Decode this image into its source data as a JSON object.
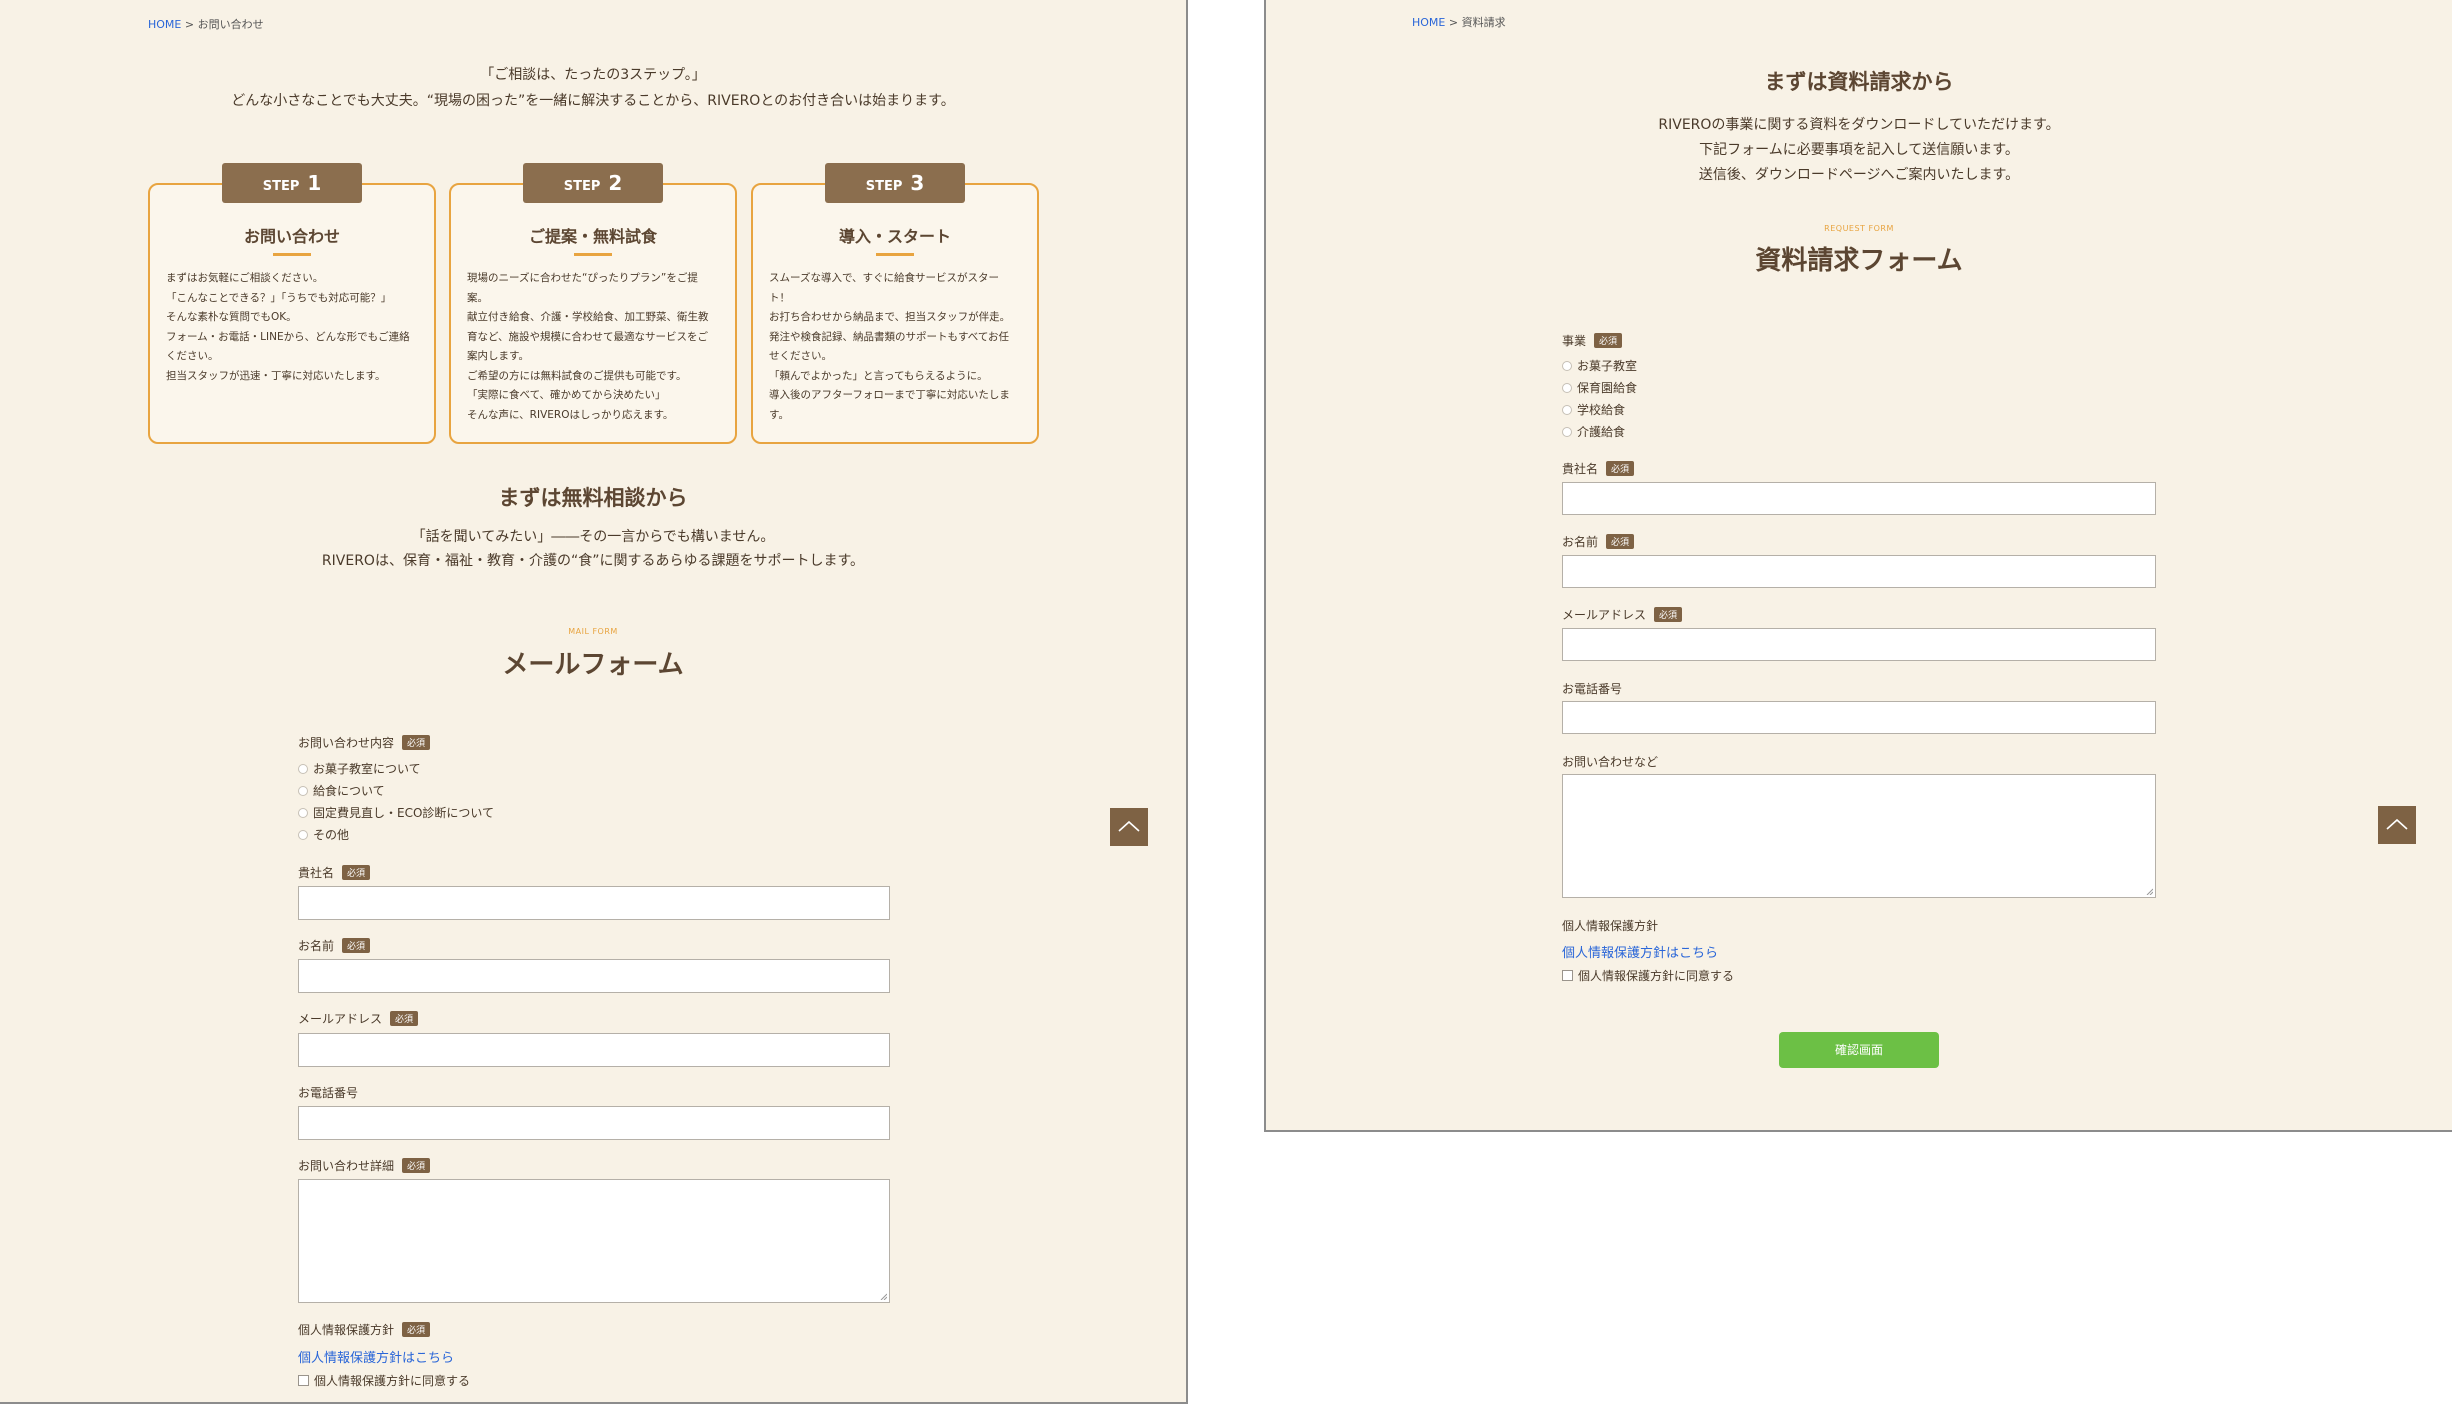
{
  "left": {
    "breadcrumb": {
      "home": "HOME",
      "separator": " > ",
      "current": "お問い合わせ"
    },
    "intro": {
      "line1": "「ご相談は、たったの3ステップ。」",
      "line2": "どんな小さなことでも大丈夫。“現場の困った”を一緒に解決することから、RIVEROとのお付き合いは始まります。"
    },
    "steps": [
      {
        "label": "STEP",
        "number": "1",
        "title": "お問い合わせ",
        "body": "まずはお気軽にご相談ください。\n「こんなことできる？」「うちでも対応可能？」\nそんな素朴な質問でもOK。\nフォーム・お電話・LINEから、どんな形でもご連絡\nください。\n担当スタッフが迅速・丁寧に対応いたします。"
      },
      {
        "label": "STEP",
        "number": "2",
        "title": "ご提案・無料試食",
        "body": "現場のニーズに合わせた“ぴったりプラン”をご提\n案。\n献立付き給食、介護・学校給食、加工野菜、衛生教\n育など、施設や規模に合わせて最適なサービスをご\n案内します。\nご希望の方には無料試食のご提供も可能です。\n「実際に食べて、確かめてから決めたい」\nそんな声に、RIVEROはしっかり応えます。"
      },
      {
        "label": "STEP",
        "number": "3",
        "title": "導入・スタート",
        "body": "スムーズな導入で、すぐに給食サービスがスター\nト！\nお打ち合わせから納品まで、担当スタッフが伴走。\n発注や検食記録、納品書類のサポートもすべてお任\nせください。\n「頼んでよかった」と言ってもらえるように。\n導入後のアフターフォローまで丁寧に対応いたしま\nす。"
      }
    ],
    "consult": {
      "title": "まずは無料相談から",
      "line1": "「話を聞いてみたい」――その一言からでも構いません。",
      "line2": "RIVEROは、保育・福祉・教育・介護の“食”に関するあらゆる課題をサポートします。"
    },
    "form": {
      "subtitle": "MAIL FORM",
      "title": "メールフォーム",
      "required": "必須",
      "inquiry_label": "お問い合わせ内容",
      "inquiry_options": [
        "お菓子教室について",
        "給食について",
        "固定費見直し・ECO診断について",
        "その他"
      ],
      "company_label": "貴社名",
      "name_label": "お名前",
      "email_label": "メールアドレス",
      "phone_label": "お電話番号",
      "detail_label": "お問い合わせ詳細",
      "privacy_label": "個人情報保護方針",
      "privacy_link": "個人情報保護方針はこちら",
      "privacy_agree": "個人情報保護方針に同意する"
    }
  },
  "right": {
    "breadcrumb": {
      "home": "HOME",
      "separator": " > ",
      "current": "資料請求"
    },
    "heading": "まずは資料請求から",
    "intro": {
      "line1": "RIVEROの事業に関する資料をダウンロードしていただけます。",
      "line2": "下記フォームに必要事項を記入して送信願います。",
      "line3": "送信後、ダウンロードページへご案内いたします。"
    },
    "form": {
      "subtitle": "REQUEST FORM",
      "title": "資料請求フォーム",
      "required": "必須",
      "business_label": "事業",
      "business_options": [
        "お菓子教室",
        "保育園給食",
        "学校給食",
        "介護給食"
      ],
      "company_label": "貴社名",
      "name_label": "お名前",
      "email_label": "メールアドレス",
      "phone_label": "お電話番号",
      "inquiry_label": "お問い合わせなど",
      "privacy_label": "個人情報保護方針",
      "privacy_link": "個人情報保護方針はこちら",
      "privacy_agree": "個人情報保護方針に同意する",
      "confirm_button": "確認画面"
    }
  },
  "icons": {
    "totop": "chevron-up-icon"
  },
  "colors": {
    "background": "#f8f2e6",
    "accent": "#e8a440",
    "brown": "#7e6244",
    "link": "#2a66d8",
    "button": "#6cc045"
  }
}
